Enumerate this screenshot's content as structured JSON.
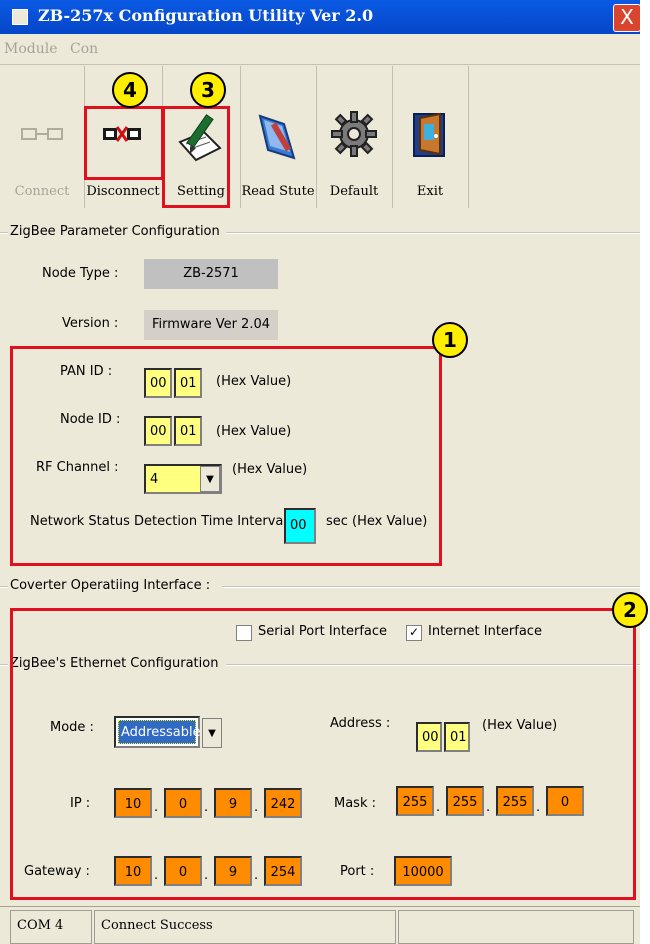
{
  "window": {
    "title": "ZB-257x Configuration Utility Ver 2.0",
    "close_glyph": "X"
  },
  "menu": {
    "items": [
      "Module",
      "Con"
    ]
  },
  "toolbar": {
    "buttons": [
      {
        "label": "Connect",
        "icon": "connect-icon"
      },
      {
        "label": "Disconnect",
        "icon": "disconnect-icon"
      },
      {
        "label": "Setting",
        "icon": "setting-icon"
      },
      {
        "label": "Read Stute",
        "icon": "read-state-icon"
      },
      {
        "label": "Default",
        "icon": "gear-icon"
      },
      {
        "label": "Exit",
        "icon": "exit-door-icon"
      }
    ]
  },
  "zigbee": {
    "group_title": "ZigBee Parameter Configuration",
    "node_type_label": "Node Type :",
    "node_type_value": "ZB-2571",
    "version_label": "Version :",
    "version_value": "Firmware Ver 2.04",
    "pan_id_label": "PAN ID :",
    "pan_id": [
      "00",
      "01"
    ],
    "node_id_label": "Node ID :",
    "node_id": [
      "00",
      "01"
    ],
    "rf_channel_label": "RF Channel :",
    "rf_channel_value": "4",
    "hex_note": "(Hex Value)",
    "interval_label": "Network Status Detection Time Interval :",
    "interval_value": "00",
    "interval_unit": "sec (Hex Value)"
  },
  "converter": {
    "group_title": "Coverter Operatiing Interface :",
    "serial_label": "Serial Port Interface",
    "serial_checked": false,
    "internet_label": "Internet Interface",
    "internet_checked": true
  },
  "ethernet": {
    "group_title": "ZigBee's Ethernet Configuration",
    "mode_label": "Mode :",
    "mode_value": "Addressable",
    "address_label": "Address :",
    "address": [
      "00",
      "01"
    ],
    "hex_note": "(Hex Value)",
    "ip_label": "IP :",
    "ip": [
      "10",
      "0",
      "9",
      "242"
    ],
    "mask_label": "Mask :",
    "mask": [
      "255",
      "255",
      "255",
      "0"
    ],
    "gateway_label": "Gateway :",
    "gateway": [
      "10",
      "0",
      "9",
      "254"
    ],
    "port_label": "Port :",
    "port_value": "10000",
    "dot": "."
  },
  "status": {
    "port": "COM 4",
    "message": "Connect Success"
  },
  "annotations": {
    "badges": [
      "4",
      "3",
      "1",
      "2"
    ]
  },
  "colors": {
    "highlight_red": "#e0101f",
    "badge_yellow": "#ffee00",
    "field_yellow": "#ffff80",
    "field_orange": "#ff8c00",
    "field_cyan": "#00ffff"
  }
}
